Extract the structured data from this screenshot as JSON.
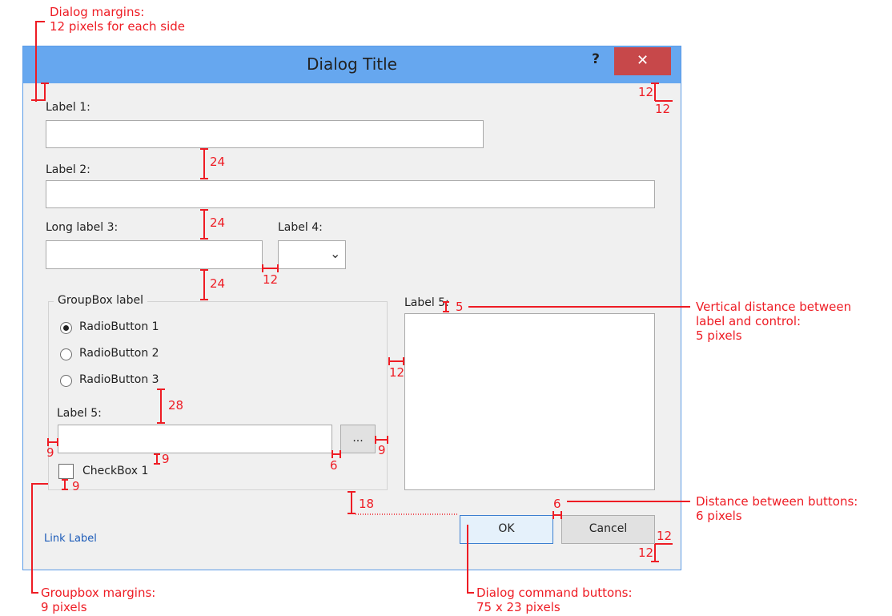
{
  "dialog": {
    "title": "Dialog Title",
    "help_glyph": "?",
    "close_glyph": "✕",
    "label1": "Label 1:",
    "label2": "Label 2:",
    "label3": "Long label  3:",
    "label4": "Label 4:",
    "groupbox_label": "GroupBox label",
    "radios": [
      "RadioButton 1",
      "RadioButton 2",
      "RadioButton 3"
    ],
    "selected_radio": 0,
    "group_label5": "Label 5:",
    "browse_label": "...",
    "checkbox_label": "CheckBox 1",
    "label5_right": "Label 5:",
    "ok_label": "OK",
    "cancel_label": "Cancel",
    "link_label": "Link Label",
    "dropdown_glyph": "⌄"
  },
  "annotations": {
    "dialog_margins": [
      "Dialog margins:",
      "12 pixels for  each side"
    ],
    "vertical_distance": [
      "Vertical distance between",
      "label and control:",
      "5 pixels"
    ],
    "distance_buttons": [
      "Distance between buttons:",
      "6 pixels"
    ],
    "groupbox_margins": [
      "Groupbox margins:",
      "9 pixels"
    ],
    "command_buttons": [
      "Dialog command buttons:",
      "75 x 23 pixels"
    ],
    "m24a": "24",
    "m24b": "24",
    "m24c": "24",
    "m12_between": "12",
    "m12_group": "12",
    "m12_tr_h": "12",
    "m12_tr_v": "12",
    "m12_br_h": "12",
    "m12_br_v": "12",
    "m5": "5",
    "m28": "28",
    "m9_left": "9",
    "m9_right": "9",
    "m9_under": "9",
    "m9_check": "9",
    "m6_browse": "6",
    "m6_buttons": "6",
    "m18": "18"
  },
  "colors": {
    "annotation": "#ee1c24",
    "titlebar": "#66a7ef",
    "close_button": "#c7484a",
    "link": "#1c5bb8"
  }
}
